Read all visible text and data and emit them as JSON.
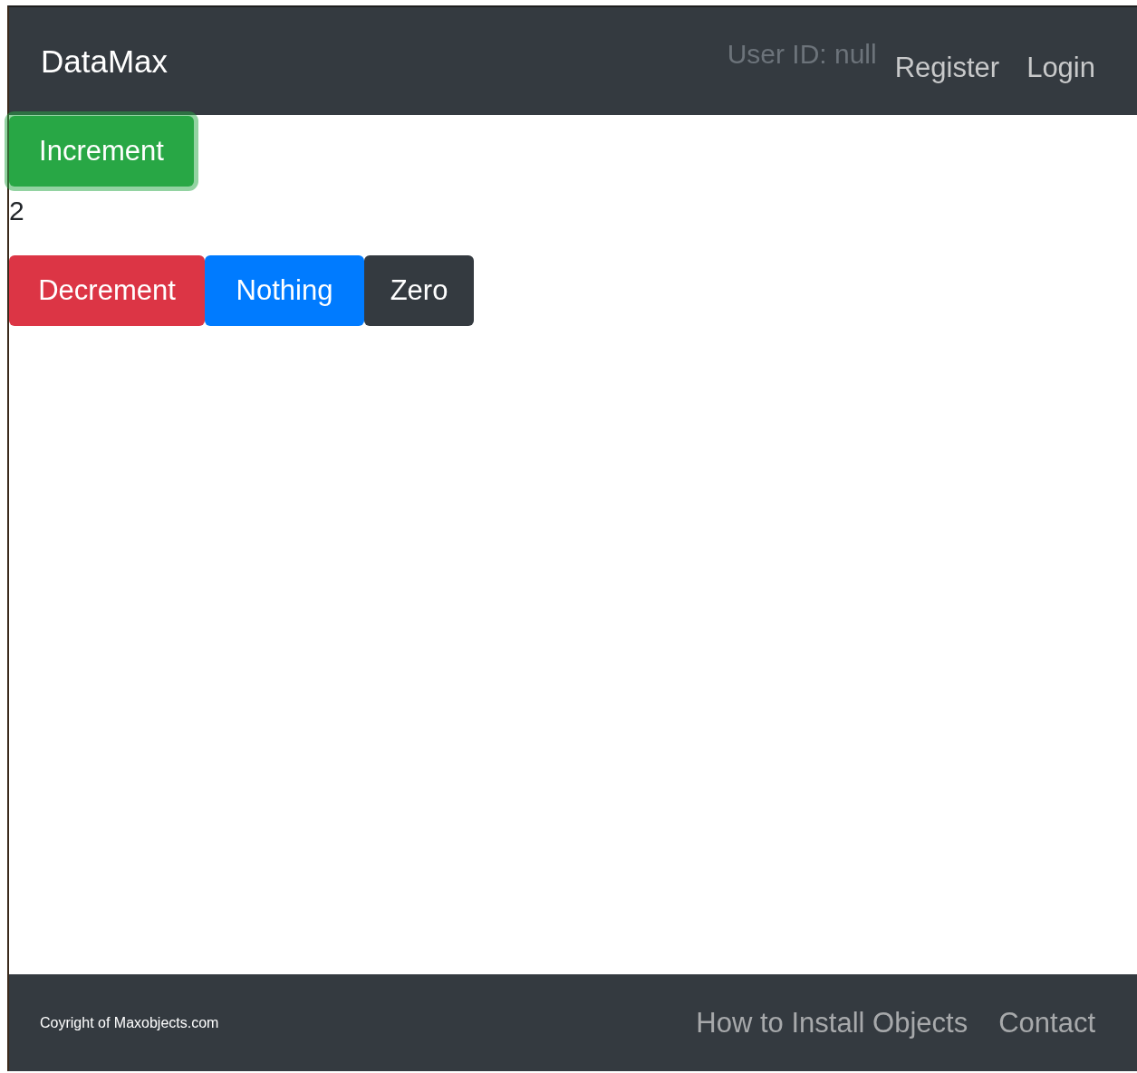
{
  "navbar": {
    "brand": "DataMax",
    "user_id": "User ID: null",
    "links": [
      {
        "label": "Register"
      },
      {
        "label": "Login"
      }
    ]
  },
  "increment_button": {
    "label": "Increment",
    "kind": "success",
    "focused": true
  },
  "counter": "2",
  "buttons": [
    {
      "label": "Decrement",
      "kind": "danger",
      "focused": false
    },
    {
      "label": "Nothing",
      "kind": "primary",
      "focused": false
    },
    {
      "label": "Zero",
      "kind": "dark",
      "focused": false
    }
  ],
  "footer": {
    "copyright": "Coyright of Maxobjects.com",
    "links": [
      {
        "label": "How to Install Objects"
      },
      {
        "label": "Contact"
      }
    ]
  }
}
